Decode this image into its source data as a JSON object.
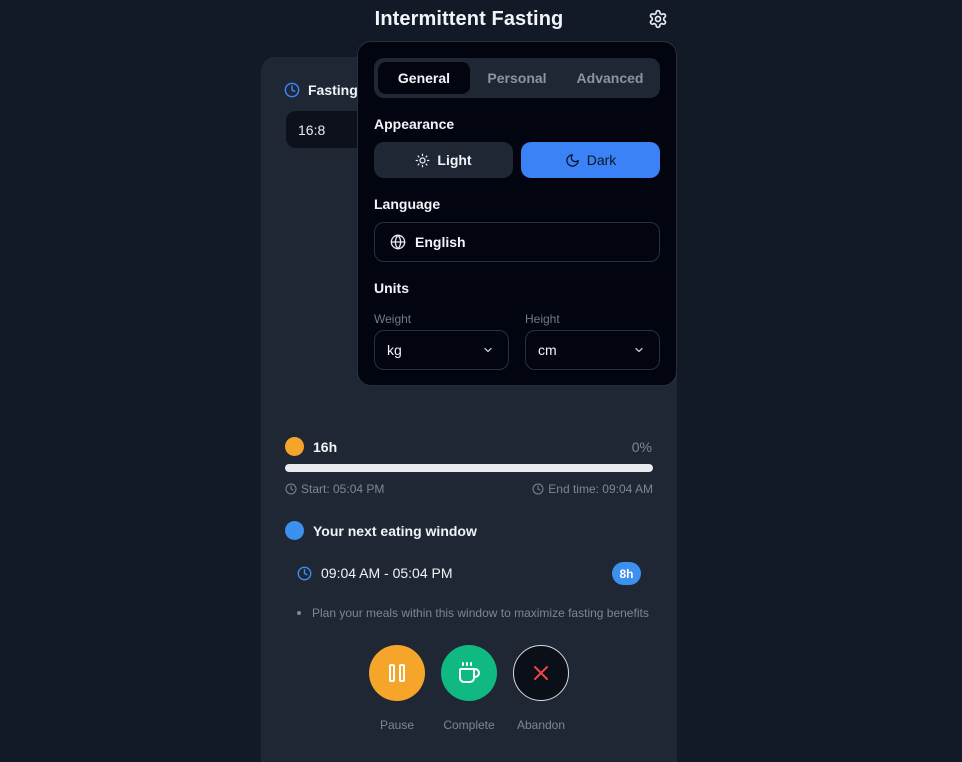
{
  "header": {
    "title": "Intermittent Fasting"
  },
  "tracker": {
    "plan_label": "Fasting",
    "plan_value": "16:8",
    "progress": {
      "hours": "16h",
      "percent_text": "0%",
      "fraction": 0.0,
      "start_text": "Start: 05:04 PM",
      "end_text": "End time: 09:04 AM"
    },
    "eating_window": {
      "title": "Your next eating window",
      "range": "09:04 AM - 05:04 PM",
      "hours_badge": "8h",
      "tip": "Plan your meals within this window to maximize fasting benefits"
    },
    "actions": {
      "pause": "Pause",
      "complete": "Complete",
      "abandon": "Abandon"
    }
  },
  "settings": {
    "tabs": [
      "General",
      "Personal",
      "Advanced"
    ],
    "active_tab": "General",
    "appearance": {
      "heading": "Appearance",
      "light": "Light",
      "dark": "Dark",
      "selected": "Dark"
    },
    "language": {
      "heading": "Language",
      "value": "English"
    },
    "units": {
      "heading": "Units",
      "weight_label": "Weight",
      "weight_value": "kg",
      "height_label": "Height",
      "height_value": "cm"
    }
  },
  "colors": {
    "background": "#131a27",
    "card": "#1f2735",
    "accent_blue": "#3b82f6",
    "fasting_orange": "#f5a52a",
    "complete_green": "#10b981",
    "abandon_red": "#ef4444"
  }
}
